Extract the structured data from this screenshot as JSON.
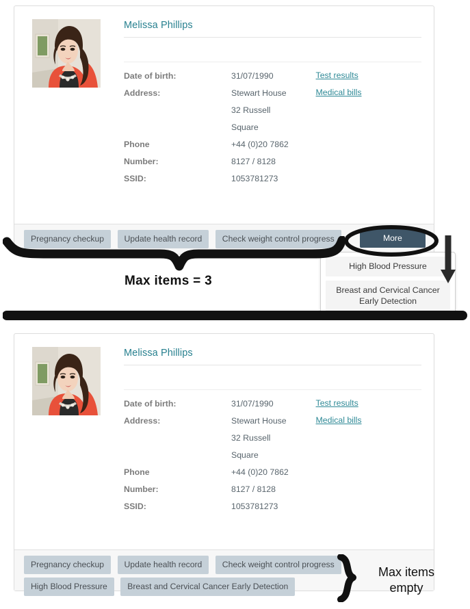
{
  "patient": {
    "name": "Melissa Phillips",
    "photo_alt": "patient-portrait",
    "fields": [
      {
        "label": "Date of birth:",
        "value": "31/07/1990"
      },
      {
        "label": "Address:",
        "value": "Stewart House"
      },
      {
        "label": "",
        "value": "32 Russell"
      },
      {
        "label": "",
        "value": "Square"
      },
      {
        "label": "Phone",
        "value": "+44 (0)20 7862"
      },
      {
        "label": "Number:",
        "value": "8127 / 8128"
      },
      {
        "label": "SSID:",
        "value": "1053781273"
      }
    ],
    "links": [
      {
        "label": "Test results"
      },
      {
        "label": "Medical bills"
      }
    ]
  },
  "card_top": {
    "actions": [
      "Pregnancy checkup",
      "Update health record",
      "Check weight control progress"
    ],
    "more_label": "More",
    "dropdown": {
      "items": [
        "High Blood Pressure",
        "Breast and Cervical Cancer Early Detection"
      ]
    }
  },
  "card_bottom": {
    "actions": [
      "Pregnancy checkup",
      "Update health record",
      "Check weight control progress",
      "High Blood Pressure",
      "Breast and Cervical Cancer Early Detection"
    ]
  },
  "annotations": {
    "max_items_3": "Max items = 3",
    "max_items_empty": "Max items\nempty"
  },
  "colors": {
    "accent_link": "#2e8996",
    "name_teal": "#27808f",
    "action_button": "#c5d0d8",
    "more_button": "#3f5668",
    "footer_bg": "#f7f7f7",
    "card_border": "#dcdcdc",
    "annotation_ink": "#111111"
  }
}
